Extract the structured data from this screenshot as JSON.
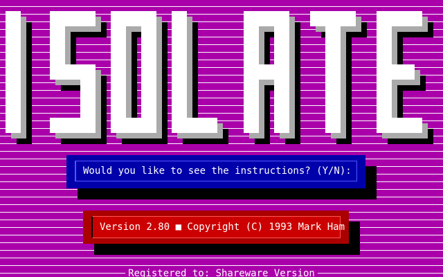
{
  "title": {
    "letters": [
      "I",
      "S",
      "O",
      "L",
      "A",
      "T",
      "E"
    ],
    "face_color": "#ffffff",
    "bevel_color": "#aaaaaa",
    "shadow_color": "#000000"
  },
  "background": {
    "color": "#aa00aa",
    "stripe_color": "#ffffff"
  },
  "prompt": {
    "question": "Would you like to see the instructions? (Y/N):",
    "box_color": "#0000aa",
    "border_color": "#5555ff"
  },
  "version_box": {
    "text": "Version 2.80 ■ Copyright (C) 1993 Mark Ham",
    "box_color": "#aa0000"
  },
  "registration": {
    "text": "Registered to: Shareware Version"
  }
}
